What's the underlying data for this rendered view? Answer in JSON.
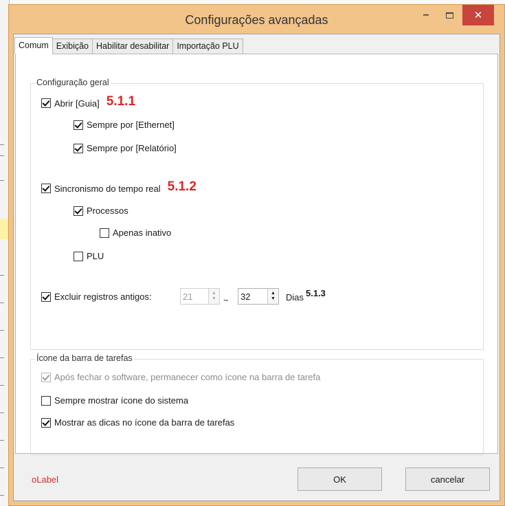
{
  "window": {
    "title": "Configurações avançadas",
    "minimize_glyph": "–",
    "close_glyph": "✕"
  },
  "tabs": [
    {
      "label": "Comum",
      "active": true
    },
    {
      "label": "Exibição",
      "active": false
    },
    {
      "label": "Habilitar desabilitar",
      "active": false
    },
    {
      "label": "Importação PLU",
      "active": false
    }
  ],
  "general": {
    "title": "Configuração geral",
    "open_guide": {
      "label": "Abrir [Guia]",
      "checked": true,
      "annotation": "5.1.1"
    },
    "always_ethernet": {
      "label": "Sempre por [Ethernet]",
      "checked": true
    },
    "always_report": {
      "label": "Sempre por [Relatório]",
      "checked": true
    },
    "realtime_sync": {
      "label": "Sincronismo do tempo real",
      "checked": true,
      "annotation": "5.1.2"
    },
    "processes": {
      "label": "Processos",
      "checked": true
    },
    "only_inactive": {
      "label": "Apenas inativo",
      "checked": false
    },
    "plu": {
      "label": "PLU",
      "checked": false
    },
    "delete_old": {
      "label": "Excluir registros antigos:",
      "checked": true,
      "from_value": "21",
      "separator": "~",
      "to_value": "32",
      "unit": "Dias",
      "annotation": "5.1.3"
    }
  },
  "taskbar": {
    "title": "Ícone da barra de tarefas",
    "stay_in_tray": {
      "label": "Após fechar o software, permanecer como ícone na barra de tarefa",
      "checked": true,
      "disabled": true
    },
    "always_show_icon": {
      "label": "Sempre mostrar ícone do sistema",
      "checked": false
    },
    "show_tips": {
      "label": "Mostrar as dicas no ícone da barra de tarefas",
      "checked": true
    }
  },
  "footer": {
    "status_label": "oLabel",
    "ok_label": "OK",
    "cancel_label": "cancelar"
  },
  "colors": {
    "title_bar": "#f2c48a",
    "close_button": "#c7453d",
    "annotation": "#e02424",
    "status_label": "#d42b2b"
  }
}
